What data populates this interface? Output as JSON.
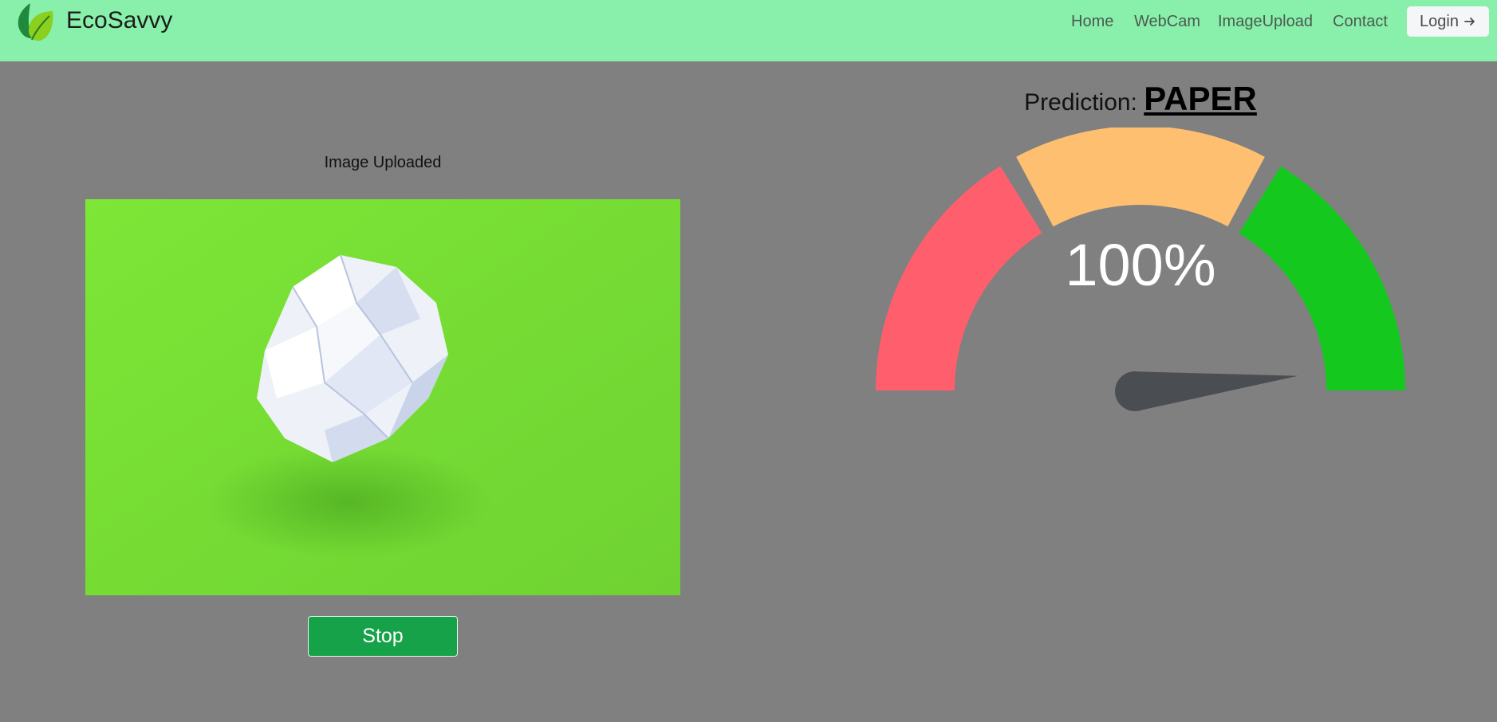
{
  "navbar": {
    "brand": "EcoSavvy",
    "links": [
      "Home",
      "WebCam",
      "ImageUpload",
      "Contact"
    ],
    "login_label": "Login",
    "background_color": "#88f0aa"
  },
  "upload_panel": {
    "title": "Image Uploaded",
    "stop_label": "Stop",
    "stop_button_color": "#16a249"
  },
  "prediction": {
    "label": "Prediction:",
    "value": "PAPER"
  },
  "gauge": {
    "percent_label": "100%",
    "needle_fraction": 0.97,
    "segment_colors": [
      "#ff5e6c",
      "#fec070",
      "#14c81e"
    ]
  },
  "icons": {
    "logo": "leaf-logo-icon",
    "login_arrow": "arrow-right-icon"
  }
}
